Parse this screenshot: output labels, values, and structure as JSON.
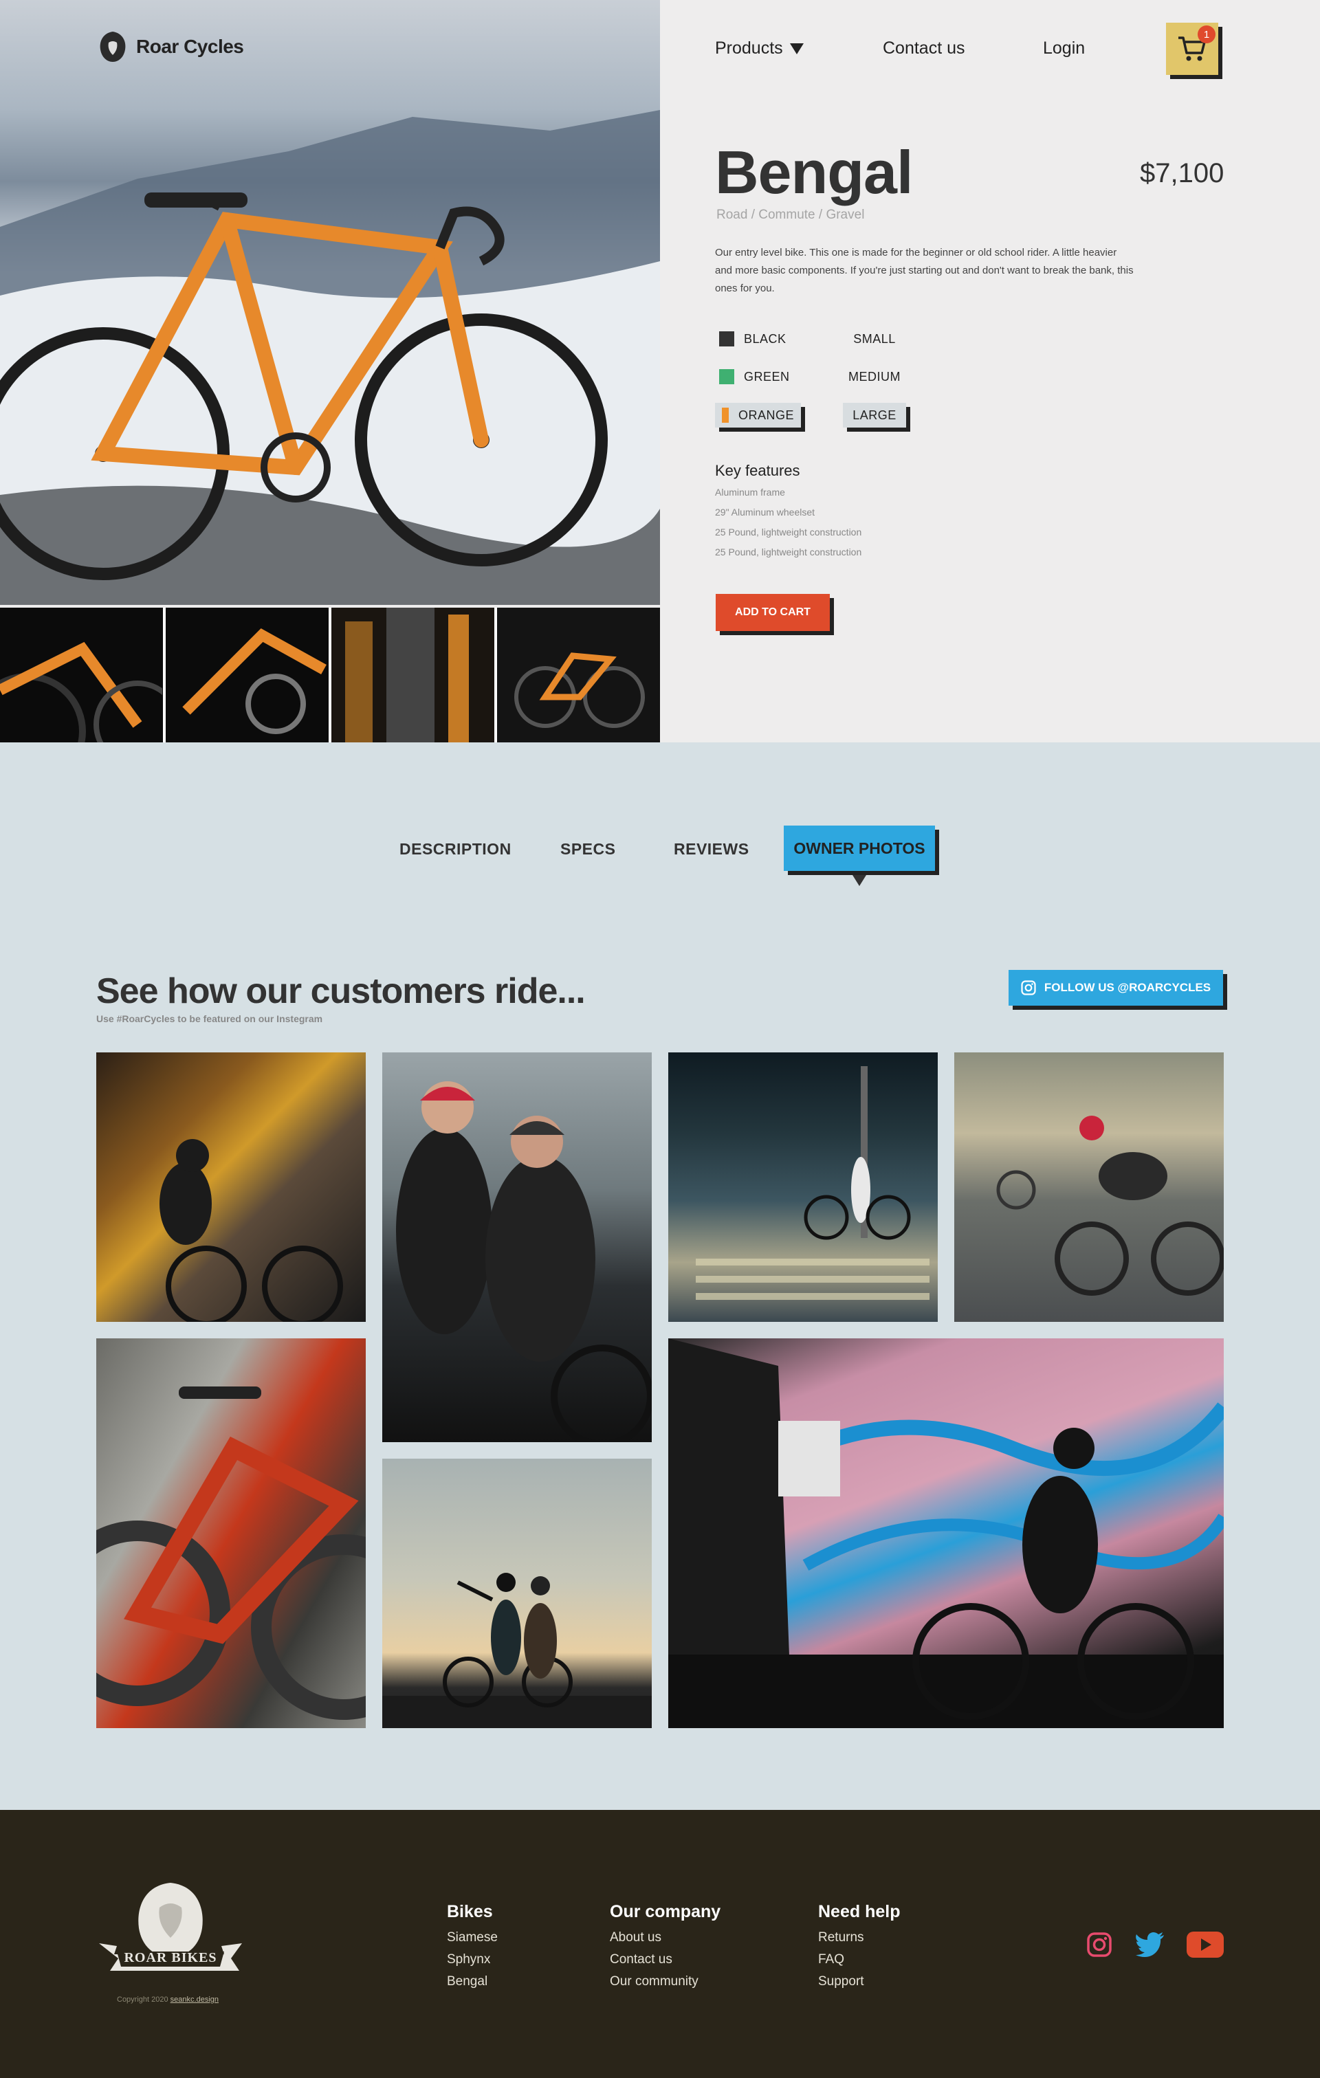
{
  "brand": {
    "name": "Roar Cycles"
  },
  "nav": {
    "products": "Products",
    "contact": "Contact us",
    "login": "Login",
    "cart_count": "1"
  },
  "product": {
    "title": "Bengal",
    "price": "$7,100",
    "categories": "Road / Commute / Gravel",
    "description": "Our entry level bike. This one is made for the beginner or old school rider. A little heavier and more basic components. If you're just starting out and don't want to break the bank, this ones for you.",
    "colors": [
      {
        "label": "BLACK",
        "color": "#333333",
        "selected": false
      },
      {
        "label": "GREEN",
        "color": "#3fb071",
        "selected": false
      },
      {
        "label": "ORANGE",
        "color": "#f0922a",
        "selected": true
      }
    ],
    "sizes": [
      {
        "label": "SMALL",
        "selected": false
      },
      {
        "label": "MEDIUM",
        "selected": false
      },
      {
        "label": "LARGE",
        "selected": true
      }
    ],
    "key_features_title": "Key features",
    "key_features": [
      "Aluminum frame",
      "29\" Aluminum wheelset",
      "25 Pound, lightweight construction",
      "25 Pound, lightweight construction"
    ],
    "add_to_cart": "ADD TO CART"
  },
  "tabs": [
    {
      "label": "DESCRIPTION",
      "active": false
    },
    {
      "label": "SPECS",
      "active": false
    },
    {
      "label": "REVIEWS",
      "active": false
    },
    {
      "label": "OWNER PHOTOS",
      "active": true
    }
  ],
  "owner_photos": {
    "title": "See how our customers ride...",
    "subtitle": "Use #RoarCycles to be featured on our Instegram",
    "follow_button": "FOLLOW US @ROARCYCLES"
  },
  "footer": {
    "logo_text": "ROAR BIKES",
    "copyright_prefix": "Copyright 2020",
    "copyright_link": "seankc.design",
    "columns": [
      {
        "title": "Bikes",
        "links": [
          "Siamese",
          "Sphynx",
          "Bengal"
        ]
      },
      {
        "title": "Our company",
        "links": [
          "About us",
          "Contact us",
          "Our community"
        ]
      },
      {
        "title": "Need help",
        "links": [
          "Returns",
          "FAQ",
          "Support"
        ]
      }
    ],
    "social": [
      "instagram-icon",
      "twitter-icon",
      "youtube-icon"
    ]
  },
  "colors": {
    "accent_red": "#df4b2b",
    "accent_blue": "#2ea7df",
    "cart_yellow": "#e1c66a",
    "footer_bg": "#2a2519",
    "section_bg": "#d6e0e4"
  }
}
